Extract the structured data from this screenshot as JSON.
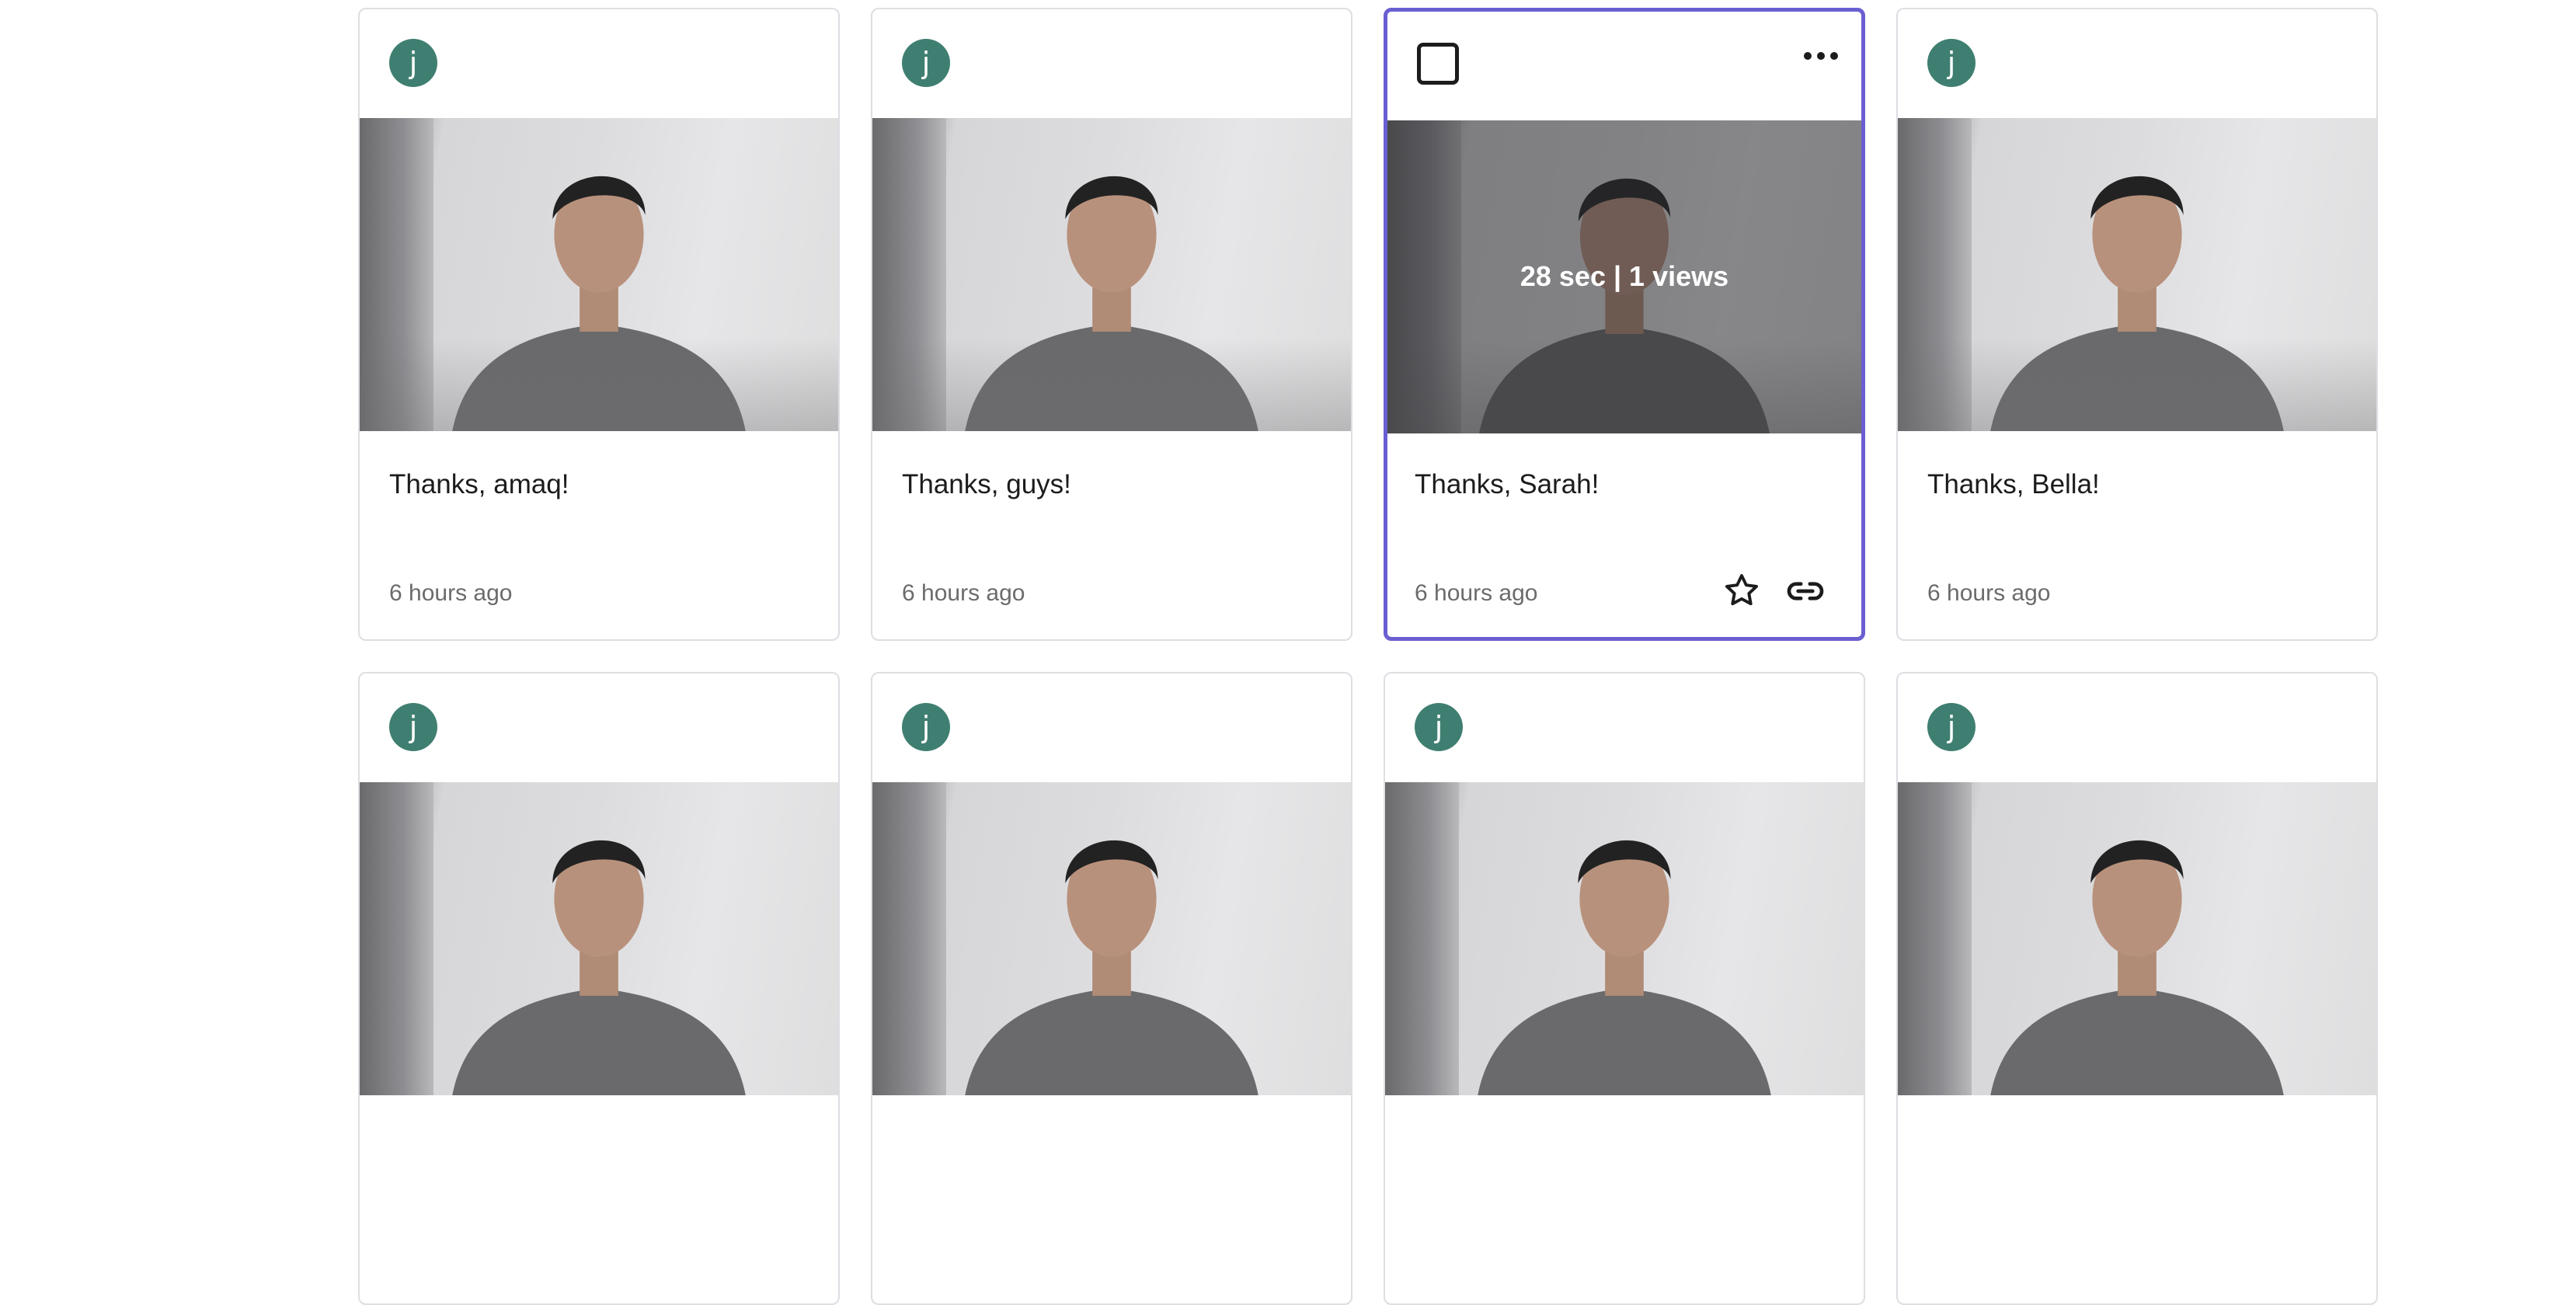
{
  "cards": [
    {
      "avatar_letter": "j",
      "title": "Thanks, amaq!",
      "time": "6 hours ago"
    },
    {
      "avatar_letter": "j",
      "title": "Thanks, guys!",
      "time": "6 hours ago"
    },
    {
      "title": "Thanks, Sarah!",
      "time": "6 hours ago",
      "stats": "28 sec | 1 views",
      "more_icon": "more-horizontal-icon",
      "star_icon": "star-icon",
      "link_icon": "link-icon"
    },
    {
      "avatar_letter": "j",
      "title": "Thanks, Bella!",
      "time": "6 hours ago"
    },
    {
      "avatar_letter": "j"
    },
    {
      "avatar_letter": "j"
    },
    {
      "avatar_letter": "j"
    },
    {
      "avatar_letter": "j"
    }
  ],
  "colors": {
    "avatar": "#3f7f71",
    "selected_border": "#6a5fd1",
    "card_border": "#dedee3"
  }
}
